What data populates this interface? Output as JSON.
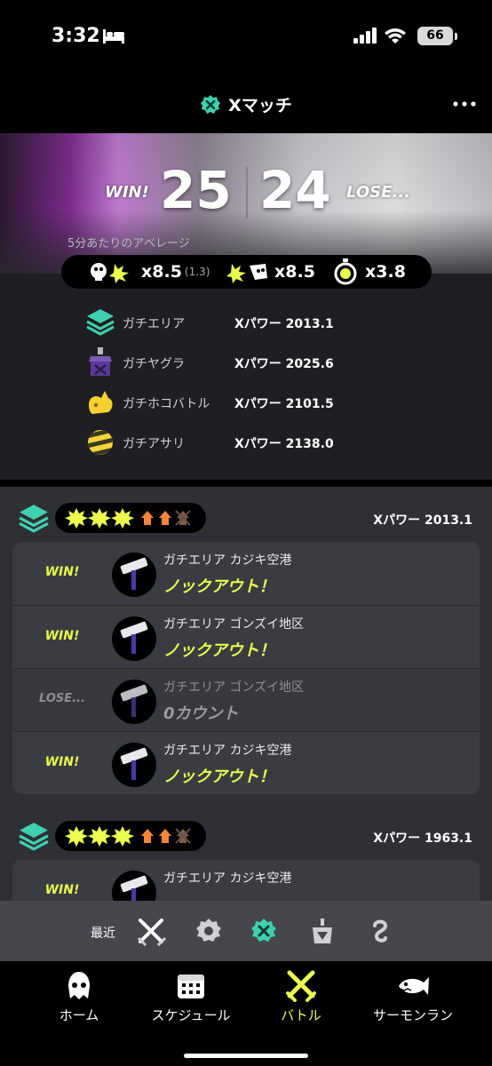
{
  "status_bar": {
    "time": "3:32",
    "battery": "66",
    "icons": [
      "bed-icon",
      "signal-icon",
      "wifi-icon",
      "battery-icon"
    ]
  },
  "header": {
    "title": "Xマッチ",
    "icons": [
      "x-match-icon",
      "more-icon"
    ]
  },
  "summary": {
    "win_label": "WIN!",
    "win_count": "25",
    "lose_count": "24",
    "lose_label": "LOSE...",
    "average_label": "5分あたりのアベレージ",
    "stats": [
      {
        "icon": "kill-assist-icon",
        "value": "x8.5",
        "sub": "(1.3)"
      },
      {
        "icon": "death-icon",
        "value": "x8.5",
        "sub": ""
      },
      {
        "icon": "special-icon",
        "value": "x3.8",
        "sub": ""
      }
    ]
  },
  "modes": [
    {
      "icon": "splat-zones-icon",
      "name": "ガチエリア",
      "power": "Xパワー 2013.1"
    },
    {
      "icon": "tower-control-icon",
      "name": "ガチヤグラ",
      "power": "Xパワー 2025.6"
    },
    {
      "icon": "rainmaker-icon",
      "name": "ガチホコバトル",
      "power": "Xパワー 2101.5"
    },
    {
      "icon": "clam-blitz-icon",
      "name": "ガチアサリ",
      "power": "Xパワー 2138.0"
    }
  ],
  "groups": [
    {
      "mode_icon": "splat-zones-icon",
      "power": "Xパワー 2013.1",
      "matches": [
        {
          "result": "WIN!",
          "title": "ガチエリア カジキ空港",
          "subtitle": "ノックアウト！"
        },
        {
          "result": "WIN!",
          "title": "ガチエリア ゴンズイ地区",
          "subtitle": "ノックアウト！"
        },
        {
          "result": "LOSE...",
          "title": "ガチエリア ゴンズイ地区",
          "subtitle": "0カウント"
        },
        {
          "result": "WIN!",
          "title": "ガチエリア カジキ空港",
          "subtitle": "ノックアウト！"
        }
      ]
    },
    {
      "mode_icon": "splat-zones-icon",
      "power": "Xパワー 1963.1",
      "matches": [
        {
          "result": "WIN!",
          "title": "ガチエリア カジキ空港",
          "subtitle": ""
        }
      ]
    }
  ],
  "filter": {
    "label": "最近",
    "buttons": [
      "all-battles-icon",
      "anarchy-icon",
      "x-match-icon",
      "league-icon",
      "private-icon"
    ]
  },
  "nav": [
    {
      "label": "ホーム",
      "icon": "home-squid-icon",
      "active": false
    },
    {
      "label": "スケジュール",
      "icon": "calendar-icon",
      "active": false
    },
    {
      "label": "バトル",
      "icon": "battle-icon",
      "active": true
    },
    {
      "label": "サーモンラン",
      "icon": "salmon-icon",
      "active": false
    }
  ],
  "colors": {
    "accent_yellow": "#eaff4f",
    "win_yellow": "#e8f84a",
    "zone_teal": "#3fd0b0",
    "rank_orange": "#f7853a"
  }
}
